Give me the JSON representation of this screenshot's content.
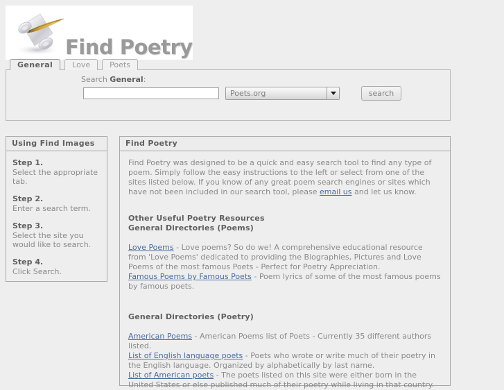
{
  "logo": {
    "title": "Find Poetry",
    "mark_icon": "scroll-quill-icon"
  },
  "tabs": [
    {
      "label": "General",
      "active": true
    },
    {
      "label": "Love",
      "active": false
    },
    {
      "label": "Poets",
      "active": false
    }
  ],
  "search": {
    "label_prefix": "Search ",
    "label_scope": "General",
    "label_suffix": ":",
    "input_value": "",
    "input_placeholder": "",
    "select_value": "Poets.org",
    "select_arrow_icon": "chevron-down-icon",
    "button_label": "search"
  },
  "sidebar": {
    "header": "Using Find Images",
    "steps": [
      {
        "title": "Step 1.",
        "text": "Select the appropriate tab."
      },
      {
        "title": "Step 2.",
        "text": "Enter a search term."
      },
      {
        "title": "Step 3.",
        "text": "Select the site you would like to search."
      },
      {
        "title": "Step 4.",
        "text": "Click Search."
      }
    ]
  },
  "main": {
    "header": "Find Poetry",
    "intro": {
      "part1": "Find Poetry was designed to be a quick and easy search tool to find any type of poem. Simply follow the easy instructions to the left or select from one of the sites listed below. If you know of any great poem search engines or sites which have not been included in our search tool, please ",
      "email_link": "email us",
      "part2": " and let us know."
    },
    "resources_heading": "Other Useful Poetry Resources",
    "poems_heading": "General Directories (Poems)",
    "poems_entries": [
      {
        "link": "Love Poems",
        "text": " - Love poems? So do we! A comprehensive educational resource from 'Love Poems' dedicated to providing the Biographies, Pictures and Love Poems of the most famous Poets - Perfect for Poetry Appreciation."
      },
      {
        "link": "Famous Poems by Famous Poets",
        "text": " - Poem lyrics of some of the most famous poems by famous poets."
      }
    ],
    "poetry_heading": "General Directories (Poetry)",
    "poetry_entries": [
      {
        "link": "American Poems",
        "text": " - American Poems list of Poets - Currently 35 different authors listed."
      },
      {
        "link": "List of English language poets",
        "text": " - Poets who wrote or write much of their poetry in the English language. Organized by alphabetically by last name."
      },
      {
        "link": "List of American poets",
        "text": " - The poets listed on this site were either born in the United States or else published much of their poetry while living in that country."
      }
    ]
  },
  "colors": {
    "page_background": "#eeeeee",
    "link": "#4a6d9e",
    "heading_text": "#5f5f5f",
    "body_text": "#8a8a8a",
    "border": "#a8a8a8",
    "logo_text": "#9a9a9a",
    "quill_gold": "#c49a34"
  }
}
